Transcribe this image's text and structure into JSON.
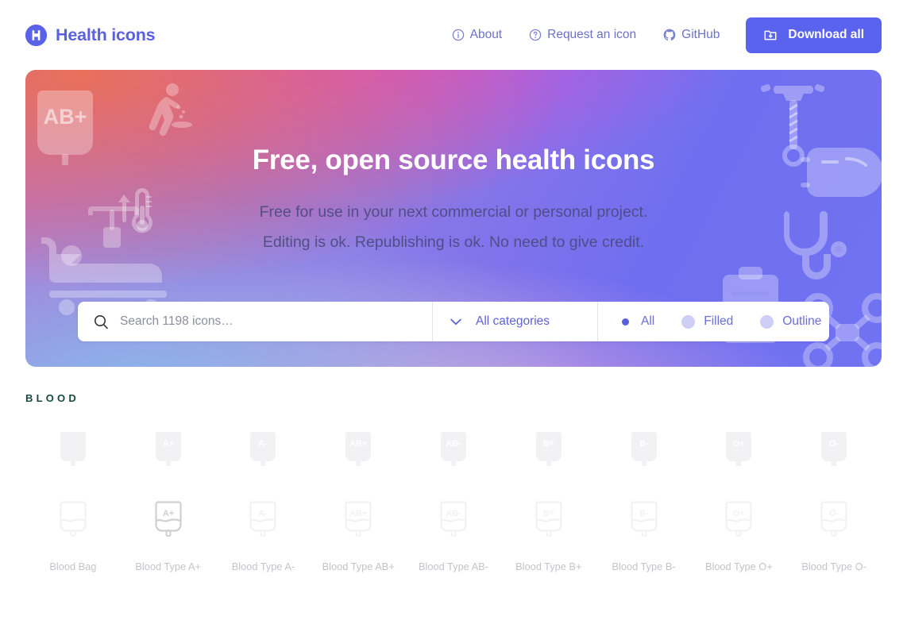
{
  "header": {
    "brand_name": "Health icons",
    "logo_letter": "H",
    "nav": [
      {
        "label": "About",
        "icon": "info-icon"
      },
      {
        "label": "Request an icon",
        "icon": "question-icon"
      },
      {
        "label": "GitHub",
        "icon": "github-icon"
      }
    ],
    "download_label": "Download all",
    "download_icon": "folder-download-icon"
  },
  "hero": {
    "title": "Free, open source health icons",
    "subtitle_line1": "Free for use in your next commercial or personal project.",
    "subtitle_line2": "Editing is ok. Republishing is ok. No need to give credit.",
    "decorative_icons": [
      "blood-bag-ab-plus-icon",
      "vomiting-person-icon",
      "thermometer-rising-icon",
      "hospital-bed-icon",
      "bone-drill-icon",
      "face-mask-icon",
      "stethoscope-icon",
      "clipboard-icon",
      "drone-icon"
    ],
    "gradient": {
      "top_left": "#e8705a",
      "top_center": "#d945d8",
      "top_right": "#7173f2",
      "bottom_left": "#8ab6ea",
      "bottom_center": "#e3a9d8",
      "bottom_right": "#6f6ef0"
    }
  },
  "search": {
    "placeholder": "Search 1198 icons…",
    "value": "",
    "icon": "search-icon",
    "total_icons": 1198,
    "category": {
      "label": "All categories",
      "icon": "chevron-down-icon"
    },
    "style_filters": [
      {
        "label": "All",
        "selected": true
      },
      {
        "label": "Filled",
        "selected": false
      },
      {
        "label": "Outline",
        "selected": false
      }
    ]
  },
  "section": {
    "title": "BLOOD",
    "title_color": "#17493f",
    "icons": [
      {
        "label": "Blood Bag",
        "glyph": ""
      },
      {
        "label": "Blood Type A+",
        "glyph": "A+"
      },
      {
        "label": "Blood Type A-",
        "glyph": "A-"
      },
      {
        "label": "Blood Type AB+",
        "glyph": "AB+"
      },
      {
        "label": "Blood Type AB-",
        "glyph": "AB-"
      },
      {
        "label": "Blood Type B+",
        "glyph": "B+"
      },
      {
        "label": "Blood Type B-",
        "glyph": "B-"
      },
      {
        "label": "Blood Type O+",
        "glyph": "O+"
      },
      {
        "label": "Blood Type O-",
        "glyph": "O-"
      }
    ],
    "rows": [
      {
        "variant": "filled"
      },
      {
        "variant": "outline"
      }
    ],
    "hovered_index": 1
  },
  "colors": {
    "brand": "#5b60e3",
    "button": "#5a63ee",
    "nav_text": "#6b72c9",
    "filter_text": "#6a6ed6",
    "icon_label": "#c3c3cb",
    "icon_fill": "#f2f2f4"
  }
}
